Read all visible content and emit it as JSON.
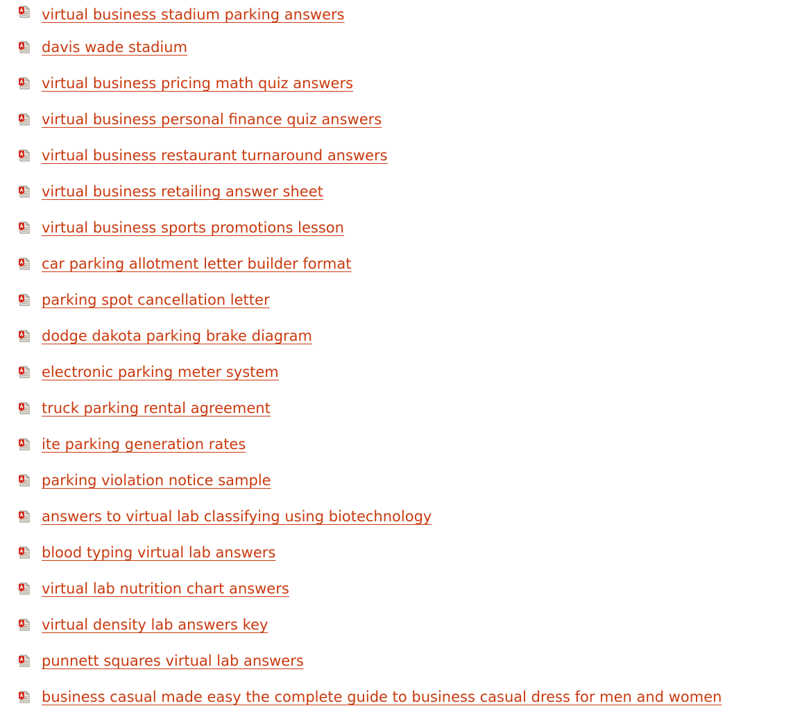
{
  "icon": "pdf-file-icon",
  "colors": {
    "link": "#c93a0f",
    "icon_red": "#d62b1f",
    "icon_page": "#e9e6dc"
  },
  "links": [
    {
      "label": "virtual business stadium parking answers"
    },
    {
      "label": "davis wade stadium"
    },
    {
      "label": "virtual business pricing math quiz answers"
    },
    {
      "label": "virtual business personal finance quiz answers"
    },
    {
      "label": "virtual business restaurant turnaround answers"
    },
    {
      "label": "virtual business retailing answer sheet"
    },
    {
      "label": "virtual business sports promotions lesson"
    },
    {
      "label": "car parking allotment letter builder format"
    },
    {
      "label": "parking spot cancellation letter"
    },
    {
      "label": "dodge dakota parking brake diagram"
    },
    {
      "label": "electronic parking meter system"
    },
    {
      "label": "truck parking rental agreement"
    },
    {
      "label": "ite parking generation rates"
    },
    {
      "label": "parking violation notice sample"
    },
    {
      "label": "answers to virtual lab classifying using biotechnology"
    },
    {
      "label": "blood typing virtual lab answers"
    },
    {
      "label": "virtual lab nutrition chart answers"
    },
    {
      "label": "virtual density lab answers key"
    },
    {
      "label": "punnett squares virtual lab answers"
    },
    {
      "label": "business casual made easy the complete guide to business casual dress for men and women"
    }
  ]
}
